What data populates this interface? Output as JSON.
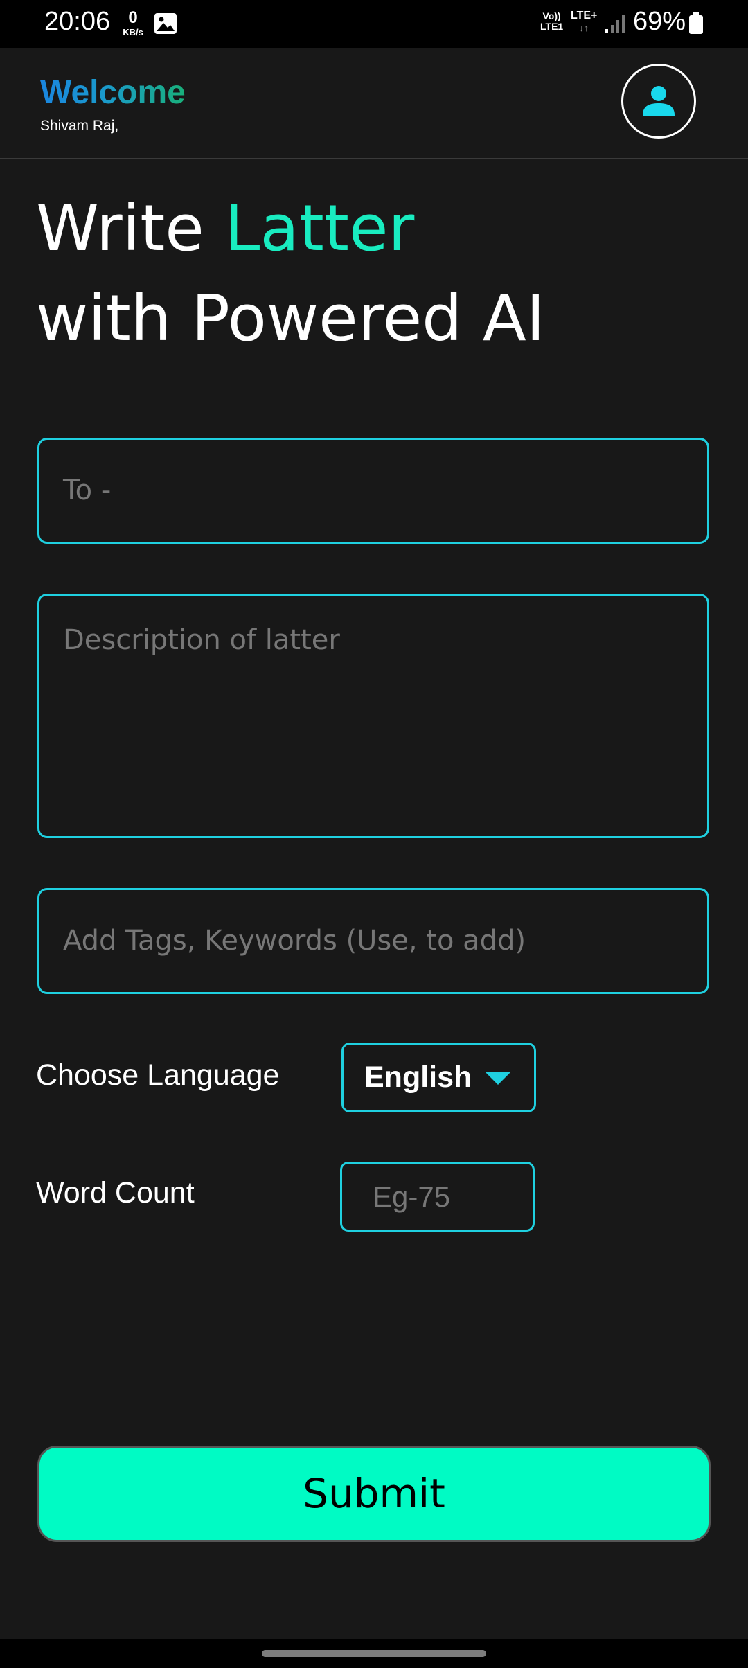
{
  "status_bar": {
    "time": "20:06",
    "net_speed_value": "0",
    "net_speed_unit": "KB/s",
    "volte_line1": "Vo))",
    "volte_line2": "LTE1",
    "lte_label": "LTE+",
    "lte_arrows": "↓↑",
    "battery_percent": "69%"
  },
  "header": {
    "welcome": "Welcome",
    "username": "Shivam Raj,"
  },
  "hero": {
    "line1_prefix": "Write ",
    "line1_accent": "Latter",
    "line2": "with Powered AI"
  },
  "form": {
    "to_placeholder": "To -",
    "description_placeholder": "Description of latter",
    "tags_placeholder": "Add Tags, Keywords (Use, to add)",
    "language_label": "Choose Language",
    "language_selected": "English",
    "word_count_label": "Word Count",
    "word_count_placeholder": "Eg-75",
    "submit_label": "Submit"
  },
  "colors": {
    "accent_teal": "#19ecc0",
    "field_border": "#1fd0e0",
    "submit_bg": "#00fbc4",
    "background": "#181818"
  }
}
